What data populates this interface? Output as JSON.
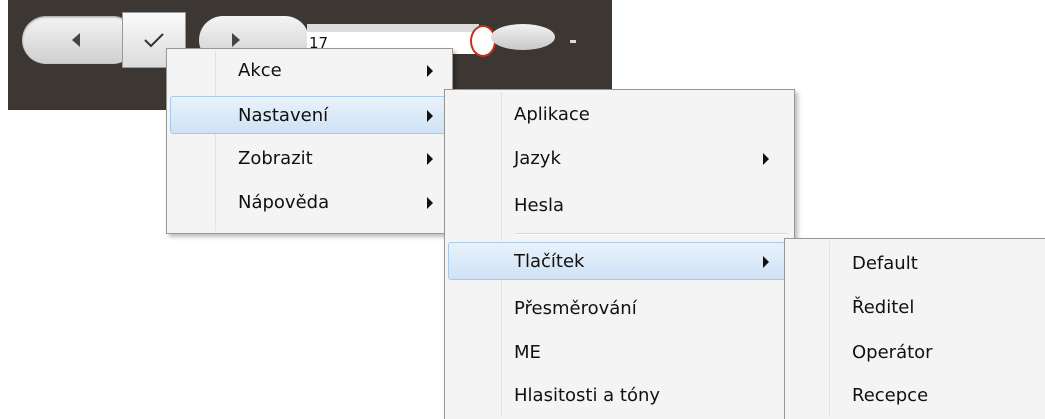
{
  "toolbar": {
    "field_value": "17",
    "icons": [
      "back-arrow-icon",
      "check-icon",
      "forward-arrow-icon"
    ]
  },
  "menus": {
    "main": {
      "items": [
        {
          "label": "Akce",
          "submenu": true
        },
        {
          "label": "Nastavení",
          "submenu": true,
          "highlighted": true
        },
        {
          "label": "Zobrazit",
          "submenu": true
        },
        {
          "label": "Nápověda",
          "submenu": true
        }
      ]
    },
    "settings": {
      "items": [
        {
          "label": "Aplikace",
          "submenu": false
        },
        {
          "label": "Jazyk",
          "submenu": true
        },
        {
          "label": "Hesla",
          "submenu": false
        },
        {
          "label": "Tlačítek",
          "submenu": true,
          "highlighted": true
        },
        {
          "label": "Přesměrování",
          "submenu": false
        },
        {
          "label": "ME",
          "submenu": false
        },
        {
          "label": "Hlasitosti a tóny",
          "submenu": false
        }
      ]
    },
    "buttons": {
      "items": [
        {
          "label": "Default"
        },
        {
          "label": "Ředitel"
        },
        {
          "label": "Operátor"
        },
        {
          "label": "Recepce"
        }
      ]
    }
  },
  "colors": {
    "toolbar_bg": "#3d3733",
    "menu_bg": "#f4f4f4",
    "highlight_border": "#a8c9ec"
  }
}
